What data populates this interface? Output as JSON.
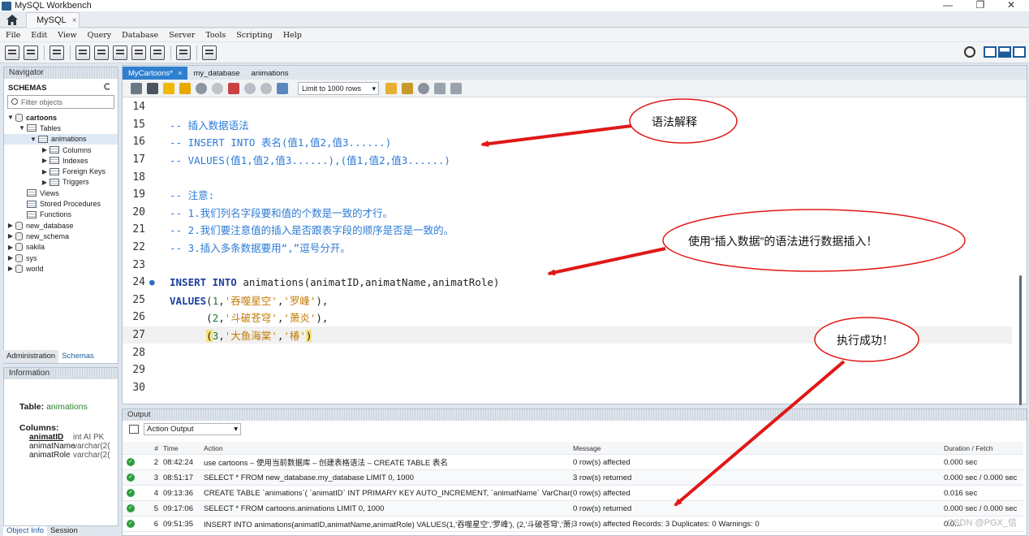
{
  "window": {
    "title": "MySQL Workbench",
    "minimize": "—",
    "restore": "❐",
    "close": "✕"
  },
  "conn_tab": {
    "label": "MySQL",
    "close": "×"
  },
  "menu": [
    "File",
    "Edit",
    "View",
    "Query",
    "Database",
    "Server",
    "Tools",
    "Scripting",
    "Help"
  ],
  "navigator": {
    "header": "Navigator",
    "schemas_title": "SCHEMAS",
    "filter_placeholder": "Filter objects",
    "tree": [
      {
        "label": "cartoons",
        "level": 0,
        "expanded": true,
        "type": "db",
        "bold": true
      },
      {
        "label": "Tables",
        "level": 1,
        "expanded": true,
        "type": "folder"
      },
      {
        "label": "animations",
        "level": 2,
        "expanded": true,
        "type": "table",
        "selected": true
      },
      {
        "label": "Columns",
        "level": 3,
        "expanded": false,
        "type": "folder"
      },
      {
        "label": "Indexes",
        "level": 3,
        "expanded": false,
        "type": "folder"
      },
      {
        "label": "Foreign Keys",
        "level": 3,
        "expanded": false,
        "type": "folder"
      },
      {
        "label": "Triggers",
        "level": 3,
        "expanded": false,
        "type": "folder"
      },
      {
        "label": "Views",
        "level": 1,
        "type": "folder"
      },
      {
        "label": "Stored Procedures",
        "level": 1,
        "type": "folder"
      },
      {
        "label": "Functions",
        "level": 1,
        "type": "folder"
      },
      {
        "label": "new_database",
        "level": 0,
        "expanded": false,
        "type": "db"
      },
      {
        "label": "new_schema",
        "level": 0,
        "expanded": false,
        "type": "db"
      },
      {
        "label": "sakila",
        "level": 0,
        "expanded": false,
        "type": "db"
      },
      {
        "label": "sys",
        "level": 0,
        "expanded": false,
        "type": "db"
      },
      {
        "label": "world",
        "level": 0,
        "expanded": false,
        "type": "db"
      }
    ],
    "tabs": {
      "administration": "Administration",
      "schemas": "Schemas"
    }
  },
  "info": {
    "header": "Information",
    "table_label": "Table:",
    "table_name": "animations",
    "columns_label": "Columns:",
    "columns": [
      {
        "name": "animatID",
        "type": "int AI PK",
        "pk": true
      },
      {
        "name": "animatName",
        "type": "varchar(2(",
        "pk": false
      },
      {
        "name": "animatRole",
        "type": "varchar(2(",
        "pk": false
      }
    ],
    "tabs": {
      "object_info": "Object Info",
      "session": "Session"
    }
  },
  "editor": {
    "tabs": [
      {
        "label": "MyCartoons*",
        "active": true,
        "close": "×"
      },
      {
        "label": "my_database",
        "active": false
      },
      {
        "label": "animations",
        "active": false
      }
    ],
    "limit": "Limit to 1000 rows",
    "lines": [
      {
        "n": "14",
        "parts": []
      },
      {
        "n": "15",
        "parts": [
          {
            "c": "cmt",
            "t": "-- 插入数据语法"
          }
        ]
      },
      {
        "n": "16",
        "parts": [
          {
            "c": "cmt",
            "t": "-- INSERT INTO 表名(值1,值2,值3......)"
          }
        ]
      },
      {
        "n": "17",
        "parts": [
          {
            "c": "cmt",
            "t": "-- VALUES(值1,值2,值3......),(值1,值2,值3......)"
          }
        ]
      },
      {
        "n": "18",
        "parts": []
      },
      {
        "n": "19",
        "parts": [
          {
            "c": "cmt",
            "t": "-- 注意:"
          }
        ]
      },
      {
        "n": "20",
        "parts": [
          {
            "c": "cmt",
            "t": "-- 1.我们列名字段要和值的个数是一致的才行。"
          }
        ]
      },
      {
        "n": "21",
        "parts": [
          {
            "c": "cmt",
            "t": "-- 2.我们要注意值的插入是否跟表字段的顺序是否是一致的。"
          }
        ]
      },
      {
        "n": "22",
        "parts": [
          {
            "c": "cmt",
            "t": "-- 3.插入多条数据要用“,”逗号分开。"
          }
        ]
      },
      {
        "n": "23",
        "parts": []
      },
      {
        "n": "24",
        "dot": "●",
        "parts": [
          {
            "c": "kw",
            "t": "INSERT INTO"
          },
          {
            "c": "pl",
            "t": " animations(animatID,animatName,animatRole)"
          }
        ]
      },
      {
        "n": "25",
        "parts": [
          {
            "c": "kw",
            "t": "VALUES"
          },
          {
            "c": "pl",
            "t": "("
          },
          {
            "c": "num",
            "t": "1"
          },
          {
            "c": "pl",
            "t": ","
          },
          {
            "c": "str",
            "t": "'吞噬星空'"
          },
          {
            "c": "pl",
            "t": ","
          },
          {
            "c": "str",
            "t": "'罗峰'"
          },
          {
            "c": "pl",
            "t": "),"
          }
        ]
      },
      {
        "n": "26",
        "parts": [
          {
            "c": "pl",
            "t": "      ("
          },
          {
            "c": "num",
            "t": "2"
          },
          {
            "c": "pl",
            "t": ","
          },
          {
            "c": "str",
            "t": "'斗破苍穹'"
          },
          {
            "c": "pl",
            "t": ","
          },
          {
            "c": "str",
            "t": "'萧炎'"
          },
          {
            "c": "pl",
            "t": "),"
          }
        ]
      },
      {
        "n": "27",
        "cur": true,
        "parts": [
          {
            "c": "pl",
            "t": "      "
          },
          {
            "c": "bracehl",
            "t": "("
          },
          {
            "c": "num",
            "t": "3"
          },
          {
            "c": "pl",
            "t": ","
          },
          {
            "c": "str",
            "t": "'大鱼海棠'"
          },
          {
            "c": "pl",
            "t": ","
          },
          {
            "c": "str",
            "t": "'椿'"
          },
          {
            "c": "bracehl",
            "t": ")"
          }
        ]
      },
      {
        "n": "28",
        "parts": []
      },
      {
        "n": "29",
        "parts": []
      },
      {
        "n": "30",
        "parts": []
      }
    ]
  },
  "output": {
    "header": "Output",
    "selector": "Action Output",
    "columns": {
      "num": "#",
      "time": "Time",
      "action": "Action",
      "message": "Message",
      "duration": "Duration / Fetch"
    },
    "rows": [
      {
        "n": "2",
        "time": "08:42:24",
        "action": "use cartoons – 使用当前数据库 – 创建表格语法 – CREATE TABLE 表名",
        "message": "0 row(s) affected",
        "duration": "0.000 sec"
      },
      {
        "n": "3",
        "time": "08:51:17",
        "action": "SELECT * FROM new_database.my_database LIMIT 0, 1000",
        "message": "3 row(s) returned",
        "duration": "0.000 sec / 0.000 sec"
      },
      {
        "n": "4",
        "time": "09:13:36",
        "action": "CREATE TABLE `animations`( `animatID` INT PRIMARY KEY AUTO_INCREMENT,     `animatName` VarChar(2...",
        "message": "0 row(s) affected",
        "duration": "0.016 sec"
      },
      {
        "n": "5",
        "time": "09:17:06",
        "action": "SELECT * FROM cartoons.animations LIMIT 0, 1000",
        "message": "0 row(s) returned",
        "duration": "0.000 sec / 0.000 sec"
      },
      {
        "n": "6",
        "time": "09:51:35",
        "action": "INSERT INTO animations(animatID,animatName,animatRole) VALUES(1,'吞噬星空','罗峰'),  (2,'斗破苍穹','萧炎'...",
        "message": "3 row(s) affected Records: 3  Duplicates: 0  Warnings: 0",
        "duration": "0.0..."
      }
    ],
    "watermark": "CSDN @PGX_信"
  },
  "annotations": [
    {
      "text": "语法解释"
    },
    {
      "text": "使用“插入数据”的语法进行数据插入！"
    },
    {
      "text": "执行成功！"
    }
  ],
  "colors": {
    "accent": "#2f7fd0",
    "annotation": "#e01818",
    "comment": "#2c7bd6",
    "string": "#c37a00",
    "keyword": "#1e3e9e"
  }
}
